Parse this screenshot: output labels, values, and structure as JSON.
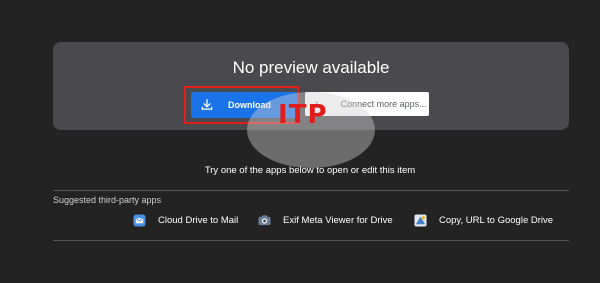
{
  "preview": {
    "title": "No preview available",
    "download_label": "Download",
    "connect_label": "Connect more apps...",
    "plus_glyph": "+"
  },
  "watermark_letters": [
    "I",
    "T",
    "P"
  ],
  "hint": "Try one of the apps below to open or edit this item",
  "suggested": {
    "title": "Suggested third-party apps",
    "apps": [
      {
        "label": "Cloud Drive to Mail",
        "icon": "cloud-mail-icon"
      },
      {
        "label": "Exif Meta Viewer for Drive",
        "icon": "camera-icon"
      },
      {
        "label": "Copy, URL to Google Drive",
        "icon": "copy-url-icon"
      }
    ]
  },
  "colors": {
    "background": "#232323",
    "card": "#4a4a4e",
    "primary": "#1a73e8",
    "highlight": "#e0201b"
  }
}
